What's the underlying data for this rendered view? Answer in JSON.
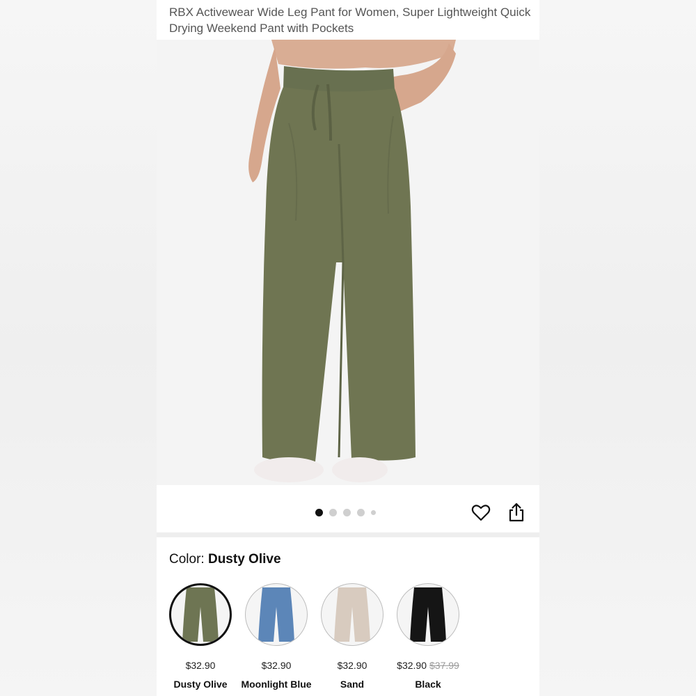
{
  "product": {
    "title": "RBX Activewear Wide Leg Pant for Women, Super Lightweight Quick Drying Weekend Pant with Pockets"
  },
  "gallery": {
    "image_count": 5,
    "active_index": 0,
    "favorite_icon": "heart-icon",
    "share_icon": "share-icon"
  },
  "color_selector": {
    "label": "Color:",
    "selected": "Dusty Olive",
    "options": [
      {
        "name": "Dusty Olive",
        "price": "$32.90",
        "list_price": "",
        "color": "#6e7553"
      },
      {
        "name": "Moonlight Blue",
        "price": "$32.90",
        "list_price": "",
        "color": "#5c86b8"
      },
      {
        "name": "Sand",
        "price": "$32.90",
        "list_price": "",
        "color": "#d8cbbf"
      },
      {
        "name": "Black",
        "price": "$32.90",
        "list_price": "$37.99",
        "color": "#151515"
      }
    ]
  },
  "colors": {
    "pant_main": "#6f7552",
    "pant_shadow": "#5e6446",
    "skin": "#d9ad94",
    "shoe": "#f1ecec"
  }
}
